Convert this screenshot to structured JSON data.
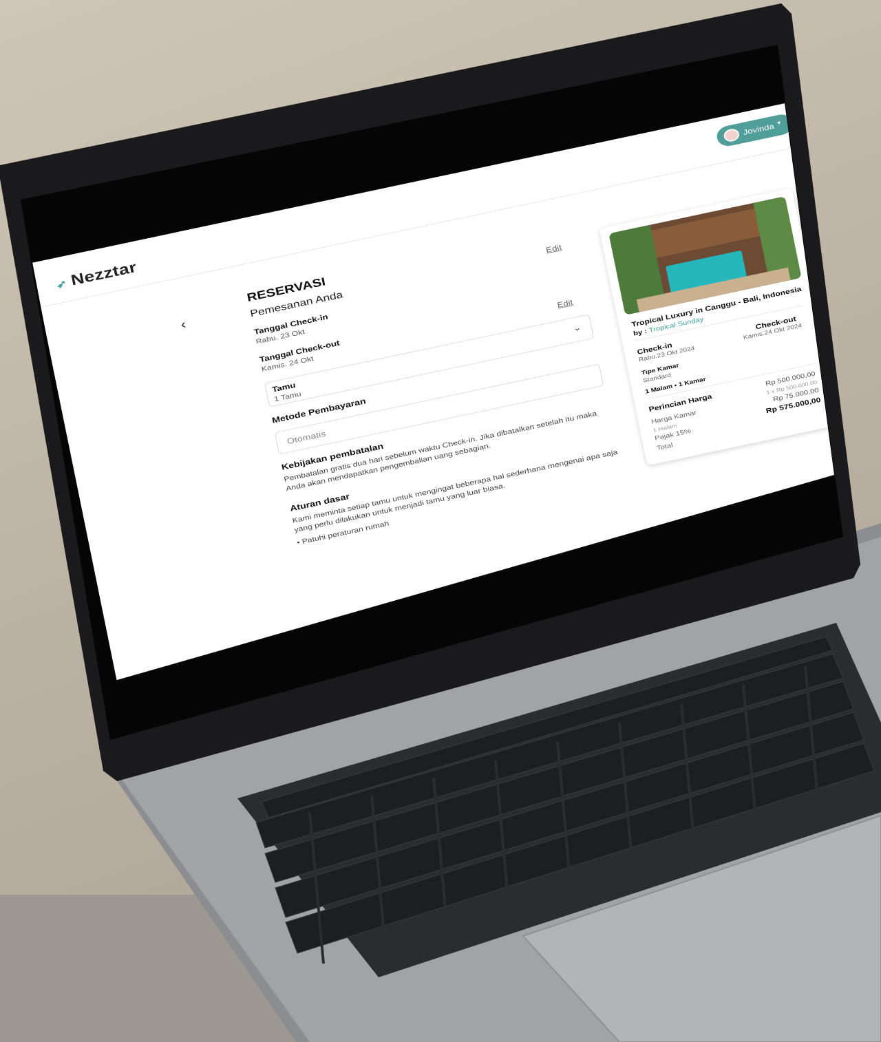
{
  "app": {
    "brand": "Nezztar",
    "user": {
      "name": "Jovinda"
    }
  },
  "reservation": {
    "heading": "RESERVASI",
    "subheading": "Pemesanan Anda",
    "checkin_label": "Tanggal Check-in",
    "checkin_value": "Rabu. 23 Okt",
    "checkout_label": "Tanggal Check-out",
    "checkout_value": "Kamis. 24 Okt",
    "edit_label": "Edit",
    "guests_label": "Tamu",
    "guests_value": "1 Tamu",
    "payment_label": "Metode Pembayaran",
    "payment_value": "Otomatis",
    "cancel_title": "Kebijakan pembatalan",
    "cancel_text": "Pembatalan gratis dua hari sebelum waktu Check-in. Jika dibatalkan setelah itu maka Anda akan mendapatkan pengembalian uang sebagian.",
    "rules_title": "Aturan dasar",
    "rules_text": "Kami meminta setiap tamu untuk mengingat beberapa hal sederhana mengenai apa saja yang perlu dilakukan untuk menjadi tamu yang luar biasa.",
    "rules_bullets": [
      "Patuhi peraturan rumah"
    ]
  },
  "summary": {
    "property_title": "Tropical Luxury in Canggu - Bali, Indonesia",
    "by_label": "by :",
    "host": "Tropical Sunday",
    "checkin_label": "Check-in",
    "checkin_value": "Rabu.23 Okt 2024",
    "checkout_label": "Check-out",
    "checkout_value": "Kamis.24 Okt 2024",
    "room_type_label": "Tipe Kamar",
    "room_type_value": "Standard",
    "nights_rooms": "1 Malam • 1 Kamar",
    "price_title": "Perincian Harga",
    "room_price_label": "Harga Kamar",
    "room_price_sub": "1 malam",
    "room_price_value": "Rp 500.000,00",
    "room_price_calc": "1 x Rp 500.000,00",
    "tax_label": "Pajak 15%",
    "tax_value": "Rp 75.000,00",
    "total_label": "Total",
    "total_value": "Rp 575.000,00"
  },
  "colors": {
    "accent": "#4f9e99",
    "link": "#3a9d9b"
  },
  "icons": [
    "bird-logo-icon",
    "chevron-left-icon",
    "chevron-down-icon",
    "caret-down-icon"
  ]
}
